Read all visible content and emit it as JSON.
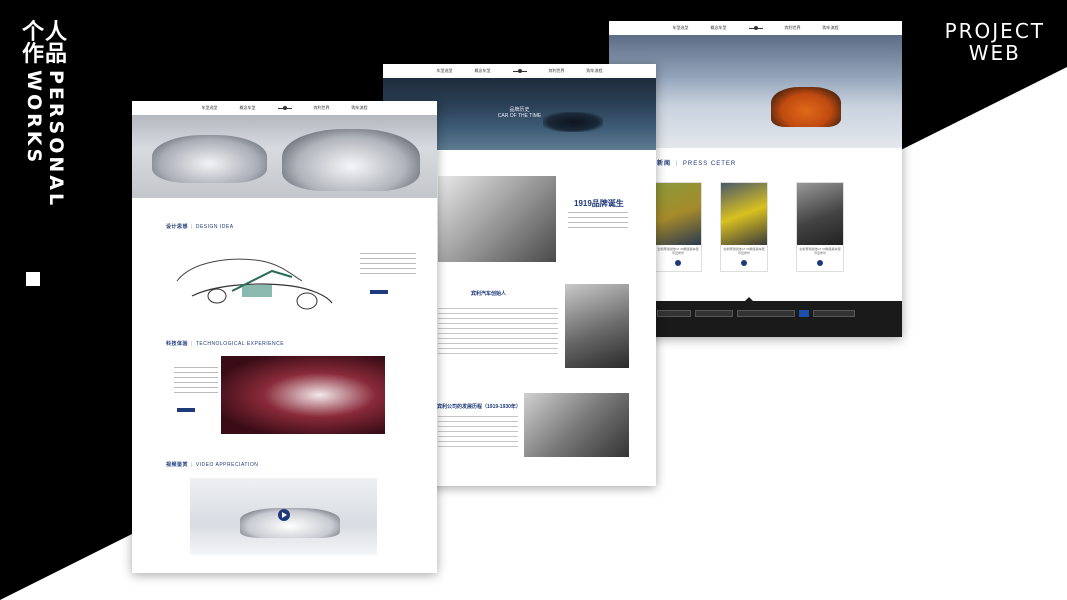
{
  "side_title": {
    "cn_line1": "个人",
    "cn_line2": "作品",
    "en": "PERSONAL WORKS"
  },
  "project": {
    "line1": "PROJECT",
    "line2": "WEB"
  },
  "nav": {
    "item1": "车型选型",
    "item2": "概念车型",
    "logo": "BENTLEY",
    "item3": "宾利世界",
    "item4": "购车流程"
  },
  "card2": {
    "hero_title": "品牌历史",
    "hero_sub": "CAR OF THE TIME",
    "year_title": "1919品牌诞生",
    "section2_title": "宾利汽车创始人",
    "section3_title": "宾利公司的发展历程（1919-1930年）"
  },
  "card3": {
    "press_zh": "新闻",
    "press_en": "PRESS CETER",
    "news_caption": "全新宾利欧陆GT V8敞篷版车型 尽显奢华"
  },
  "card1": {
    "sec1_zh": "设计思想",
    "sec1_en": "DESIGN IDEA",
    "sec2_zh": "科技体验",
    "sec2_en": "TECHNOLOGICAL EXPERIENCE",
    "sec3_zh": "视频鉴赏",
    "sec3_en": "VIDEO APPRECIATION"
  },
  "colors": {
    "brand_blue": "#1e3a7a",
    "background": "#000000"
  },
  "icons": [
    "play-icon",
    "bentley-logo-icon",
    "search-icon"
  ]
}
